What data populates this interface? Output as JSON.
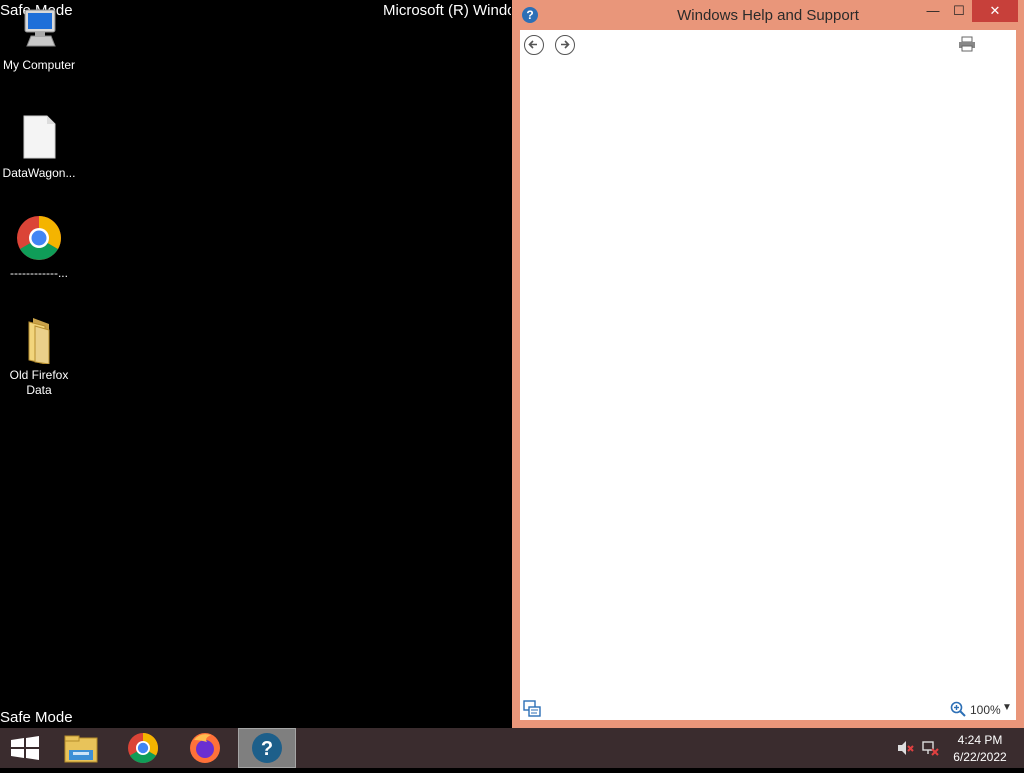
{
  "desktop": {
    "safe_mode_top": "Safe Mode",
    "safe_mode_bottom": "Safe Mode",
    "os_banner": "Microsoft (R) Windo",
    "icons": [
      {
        "label": "My Computer",
        "icon": "computer-icon"
      },
      {
        "label": "DataWagon...",
        "icon": "file-icon"
      },
      {
        "label": "------------...",
        "icon": "chrome-icon"
      },
      {
        "label": "Old Firefox Data",
        "icon": "folder-icon"
      }
    ]
  },
  "help_window": {
    "title": "Windows Help and Support",
    "minimize": "—",
    "maximize": "☐",
    "close": "✕",
    "zoom_level": "100%",
    "accent_color": "#e9967a"
  },
  "taskbar": {
    "apps": [
      "start-icon",
      "file-explorer-icon",
      "chrome-icon",
      "firefox-icon",
      "help-icon"
    ],
    "clock_time": "4:24 PM",
    "clock_date": "6/22/2022"
  }
}
